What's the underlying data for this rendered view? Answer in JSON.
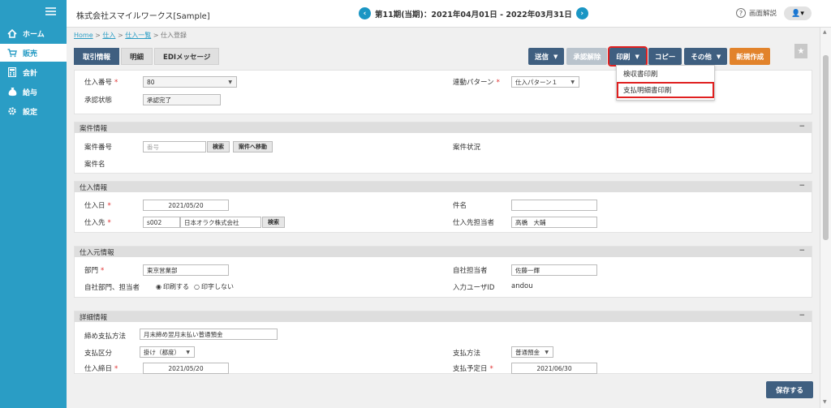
{
  "sidebar": {
    "items": [
      {
        "label": "ホーム",
        "icon": "home-icon"
      },
      {
        "label": "販売",
        "icon": "cart-icon"
      },
      {
        "label": "会計",
        "icon": "calculator-icon"
      },
      {
        "label": "給与",
        "icon": "money-bag-icon"
      },
      {
        "label": "設定",
        "icon": "gear-icon"
      }
    ]
  },
  "header": {
    "company": "株式会社スマイルワークス[Sample]",
    "period": "第11期(当期)：2021年04月01日 - 2022年03月31日",
    "prev": "‹",
    "next": "›",
    "help_icon": "?",
    "help": "画面解説",
    "user_icon": "👤▾"
  },
  "breadcrumb": {
    "home": "Home",
    "sep": ">",
    "purchase": "仕入",
    "purchase_list": "仕入一覧",
    "current": "仕入登録"
  },
  "tabs": [
    "取引情報",
    "明細",
    "EDIメッセージ"
  ],
  "toolbar": {
    "send": "送信",
    "unapprove": "承認解除",
    "print": "印刷",
    "copy": "コピー",
    "other": "その他",
    "new": "新規作成",
    "caret": "▼",
    "star": "★"
  },
  "print_menu": {
    "items": [
      "検収書印刷",
      "支払明細書印刷"
    ]
  },
  "collapse": "−",
  "select_arrow": "▼",
  "required_mark": "*",
  "top": {
    "purchase_no_label": "仕入番号",
    "purchase_no": "80",
    "approval_label": "承認状態",
    "approval": "承認完了",
    "pattern_label": "連動パターン",
    "pattern": "仕入パターン１"
  },
  "case": {
    "title": "案件情報",
    "no_label": "案件番号",
    "no_placeholder": "番号",
    "search": "検索",
    "goto": "案件へ移動",
    "name_label": "案件名",
    "status_label": "案件状況"
  },
  "purchase": {
    "title": "仕入情報",
    "date_label": "仕入日",
    "date": "2021/05/20",
    "supplier_label": "仕入先",
    "supplier_code": "s002",
    "supplier_name": "日本オラク株式会社",
    "search": "検索",
    "subject_label": "件名",
    "subject": "",
    "contact_label": "仕入先担当者",
    "contact": "高橋　大輔"
  },
  "source": {
    "title": "仕入元情報",
    "dept_label": "部門",
    "dept": "東京営業部",
    "self_label": "自社部門、担当者",
    "print_on": "印刷する",
    "print_off": "印字しない",
    "radio_on": "◉",
    "radio_off": "○",
    "staff_label": "自社担当者",
    "staff": "佐藤一輝",
    "input_user_label": "入力ユーザID",
    "input_user": "andou"
  },
  "detail": {
    "title": "詳細情報",
    "closing_label": "締め支払方法",
    "closing": "月末締め翌月末払い普通預金",
    "pay_type_label": "支払区分",
    "pay_type": "掛け（都度）",
    "close_date_label": "仕入締日",
    "close_date": "2021/05/20",
    "pay_method_label": "支払方法",
    "pay_method": "普通預金",
    "due_label": "支払予定日",
    "due": "2021/06/30"
  },
  "save": "保存する",
  "scroll": {
    "up": "▲",
    "down": "▼"
  }
}
